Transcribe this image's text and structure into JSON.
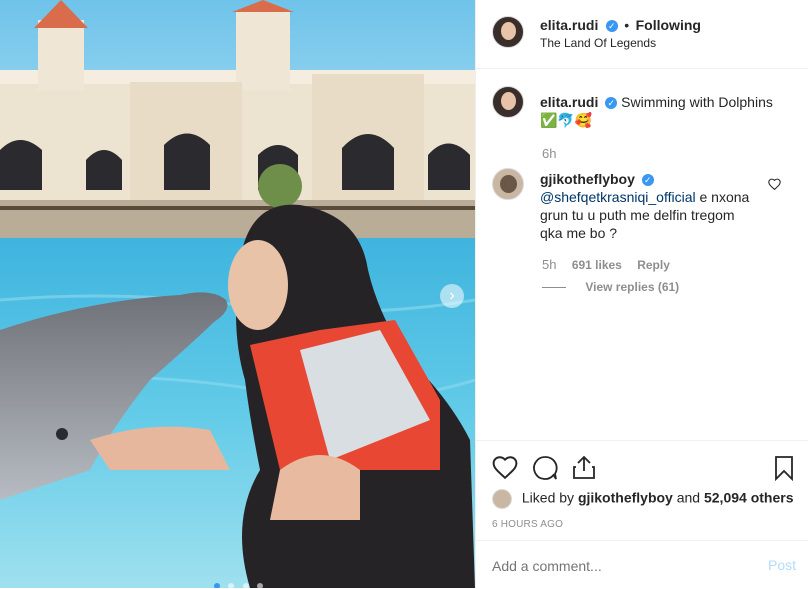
{
  "post": {
    "author": "elita.rudi",
    "follow_status": "Following",
    "separator": "•",
    "location": "The Land Of Legends",
    "caption_text": "Swimming with Dolphins",
    "caption_emojis": "✅🐬🥰",
    "caption_time": "6h",
    "verified_mark": "✓"
  },
  "comment": {
    "author": "gjikotheflyboy",
    "mention": "@shefqetkrasniqi_official",
    "text_line1": " e nxona",
    "text_line2": "grun tu u puth me delfin tregom",
    "text_line3": "qka me bo ?",
    "time": "5h",
    "likes": "691 likes",
    "reply_label": "Reply",
    "view_replies": "View replies (61)"
  },
  "likes_line": {
    "prefix": "Liked by",
    "user": "gjikotheflyboy",
    "conj": "and",
    "count": "52,094 others"
  },
  "timestamp": "6 HOURS AGO",
  "comment_input": {
    "placeholder": "Add a comment...",
    "post_label": "Post"
  },
  "icons": [
    "heart-icon",
    "comment-icon",
    "share-icon",
    "bookmark-icon",
    "chevron-right-icon",
    "small-heart-icon"
  ],
  "colors": {
    "link": "#003569",
    "verified": "#3897f0",
    "post_disabled": "#b3dbff",
    "muted": "#8e8e8e"
  },
  "carousel": {
    "dots": 4,
    "active": 0
  }
}
